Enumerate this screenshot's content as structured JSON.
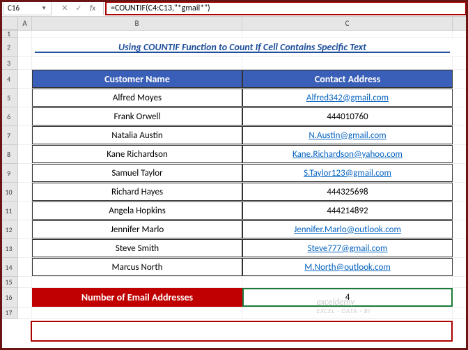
{
  "nameBox": "C16",
  "formula": "=COUNTIF(C4:C13,\"*gmail*\")",
  "columns": {
    "A": "A",
    "B": "B",
    "C": "C"
  },
  "rowNums": [
    "1",
    "2",
    "3",
    "4",
    "5",
    "6",
    "7",
    "8",
    "9",
    "10",
    "11",
    "12",
    "13",
    "14",
    "15",
    "16",
    "17"
  ],
  "title": "Using COUNTIF Function to Count If Cell Contains Specific Text",
  "headers": {
    "name": "Customer Name",
    "contact": "Contact Address"
  },
  "rows": [
    {
      "name": "Alfred Moyes",
      "contact": "Alfred342@gmail.com",
      "link": true
    },
    {
      "name": "Frank Orwell",
      "contact": "444010760",
      "link": false
    },
    {
      "name": "Natalia Austin",
      "contact": "N.Austin@gmail.com",
      "link": true
    },
    {
      "name": "Kane Richardson",
      "contact": "Kane.Richardson@yahoo.com",
      "link": true
    },
    {
      "name": "Samuel Taylor",
      "contact": "S.Taylor123@gmail.com",
      "link": true
    },
    {
      "name": "Richard Hayes",
      "contact": "444325698",
      "link": false
    },
    {
      "name": "Angela Hopkins",
      "contact": "444214892",
      "link": false
    },
    {
      "name": "Jennifer Marlo",
      "contact": "Jennifer.Marlo@outlook.com",
      "link": true
    },
    {
      "name": "Steve Smith",
      "contact": "Steve777@gmail.com",
      "link": true
    },
    {
      "name": "Marcus North",
      "contact": "M.North@outlook.com",
      "link": true
    }
  ],
  "summary": {
    "label": "Number of Email Addresses",
    "value": "4"
  },
  "watermark": {
    "brand": "exceldemy",
    "tag": "EXCEL · DATA · BI"
  }
}
